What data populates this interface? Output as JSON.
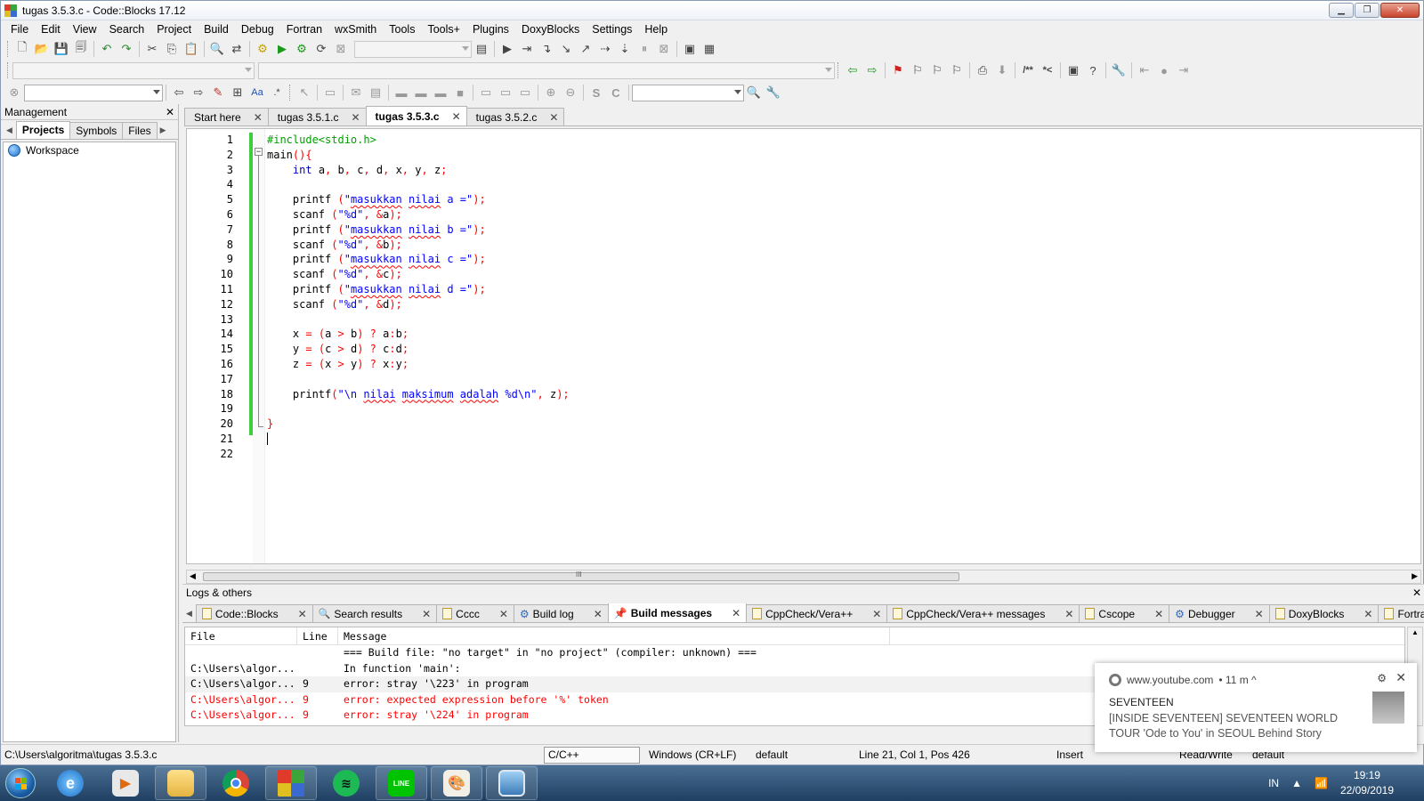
{
  "window": {
    "title": "tugas 3.5.3.c - Code::Blocks 17.12",
    "buttons": {
      "minimize": "▁",
      "maximize": "❐",
      "close": "✕"
    }
  },
  "menu": [
    "File",
    "Edit",
    "View",
    "Search",
    "Project",
    "Build",
    "Debug",
    "Fortran",
    "wxSmith",
    "Tools",
    "Tools+",
    "Plugins",
    "DoxyBlocks",
    "Settings",
    "Help"
  ],
  "management": {
    "title": "Management",
    "close": "✕",
    "tabs": [
      "Projects",
      "Symbols",
      "Files"
    ],
    "tree": [
      "Workspace"
    ]
  },
  "editor": {
    "tabs": [
      {
        "label": "Start here",
        "active": false
      },
      {
        "label": "tugas 3.5.1.c",
        "active": false
      },
      {
        "label": "tugas 3.5.3.c",
        "active": true
      },
      {
        "label": "tugas 3.5.2.c",
        "active": false
      }
    ],
    "line_numbers": [
      "1",
      "2",
      "3",
      "4",
      "5",
      "6",
      "7",
      "8",
      "9",
      "10",
      "11",
      "12",
      "13",
      "14",
      "15",
      "16",
      "17",
      "18",
      "19",
      "20",
      "21",
      "22"
    ],
    "scroll_mark": "III"
  },
  "logs": {
    "title": "Logs & others",
    "close": "✕",
    "tabs": [
      {
        "label": "Code::Blocks",
        "active": false
      },
      {
        "label": "Search results",
        "active": false
      },
      {
        "label": "Cccc",
        "active": false
      },
      {
        "label": "Build log",
        "active": false
      },
      {
        "label": "Build messages",
        "active": true
      },
      {
        "label": "CppCheck/Vera++",
        "active": false
      },
      {
        "label": "CppCheck/Vera++ messages",
        "active": false
      },
      {
        "label": "Cscope",
        "active": false
      },
      {
        "label": "Debugger",
        "active": false
      },
      {
        "label": "DoxyBlocks",
        "active": false
      },
      {
        "label": "Fortran in",
        "active": false
      }
    ],
    "headers": [
      "File",
      "Line",
      "Message"
    ],
    "rows": [
      {
        "file": "",
        "line": "",
        "message": "=== Build file: \"no target\" in \"no project\" (compiler: unknown) ===",
        "kind": "info"
      },
      {
        "file": "C:\\Users\\algor...",
        "line": "",
        "message": "In function 'main':",
        "kind": "info"
      },
      {
        "file": "C:\\Users\\algor...",
        "line": "9",
        "message": "error: stray '\\223' in program",
        "kind": "sel"
      },
      {
        "file": "C:\\Users\\algor...",
        "line": "9",
        "message": "error: expected expression before '%' token",
        "kind": "err"
      },
      {
        "file": "C:\\Users\\algor...",
        "line": "9",
        "message": "error: stray '\\224' in program",
        "kind": "err"
      }
    ]
  },
  "status": {
    "path": "C:\\Users\\algoritma\\tugas 3.5.3.c",
    "language": "C/C++",
    "eol": "Windows (CR+LF)",
    "encoding": "default",
    "position": "Line 21, Col 1, Pos 426",
    "mode": "Insert",
    "access": "Read/Write",
    "profile": "default"
  },
  "notification": {
    "source": "www.youtube.com",
    "time": "• 11 m ^",
    "title": "SEVENTEEN",
    "body": "[INSIDE SEVENTEEN] SEVENTEEN WORLD TOUR 'Ode to You' in SEOUL Behind Story",
    "gear": "⚙",
    "close": "✕"
  },
  "taskbar": {
    "lang": "IN",
    "time": "19:19",
    "date": "22/09/2019"
  },
  "colors": {
    "preprocessor": "#00a000",
    "keyword": "#0000c0",
    "string": "#0000ff",
    "operator": "#ff0000",
    "error_text": "#ff0000",
    "change_bar": "#3cce3c"
  }
}
